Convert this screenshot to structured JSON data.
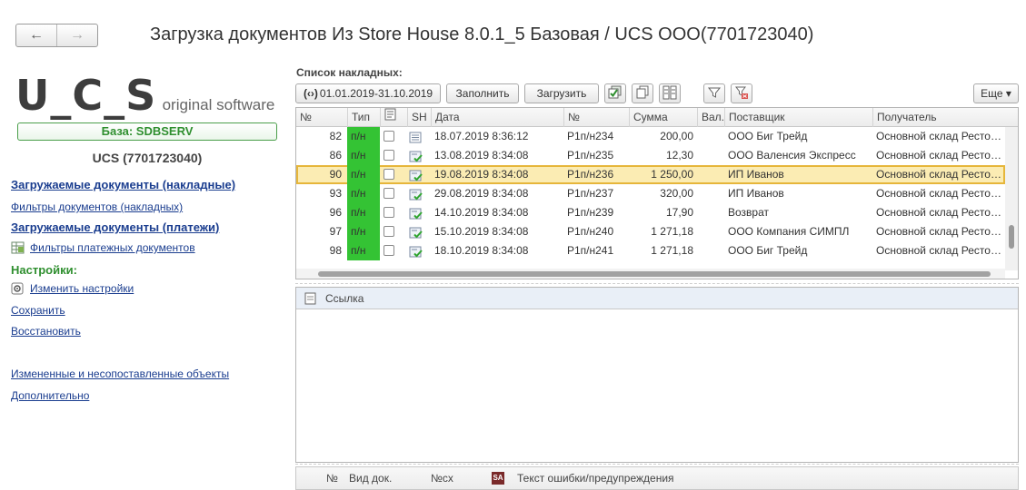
{
  "window": {
    "title": "Загрузка документов Из Store House 8.0.1_5 Базовая   / UCS ООО(7701723040)",
    "back_glyph": "←",
    "forward_glyph": "→"
  },
  "left_panel": {
    "logo_main": "U_C_S",
    "logo_sub": "original software",
    "database_label": "База: SDBSERV",
    "company": "UCS (7701723040)",
    "links": [
      {
        "label": "Загружаемые документы (накладные)",
        "bold": true
      },
      {
        "label": "Фильтры документов (накладных)",
        "bold": false
      },
      {
        "label": "Загружаемые документы (платежи)",
        "bold": true
      },
      {
        "label": "Фильтры платежных документов",
        "bold": false,
        "icon": "table-filter-icon"
      }
    ],
    "settings_heading": "Настройки:",
    "settings_links": [
      {
        "label": "Изменить настройки",
        "icon": "settings-gear-icon"
      },
      {
        "label": "Сохранить"
      },
      {
        "label": "Восстановить"
      }
    ],
    "extra_links": [
      {
        "label": "Измененные и несопоставленные объекты"
      },
      {
        "label": "Дополнительно"
      }
    ]
  },
  "list": {
    "title": "Список накладных:",
    "toolbar": {
      "period_label": "01.01.2019-31.10.2019",
      "fill_label": "Заполнить",
      "load_label": "Загрузить",
      "more_label": "Еще ▾",
      "icons": [
        "check-all-icon",
        "copy-icon",
        "columns-icon",
        "filter-icon",
        "clear-filter-icon"
      ]
    },
    "columns": [
      "№",
      "Тип",
      "",
      "SH",
      "Дата",
      "№",
      "Сумма",
      "Вал.",
      "Поставщик",
      "Получатель"
    ],
    "rows": [
      {
        "num": "82",
        "type": "п/н",
        "checked": false,
        "sh": "doc-icon",
        "date": "18.07.2019 8:36:12",
        "doc_no": "Р1п/н234",
        "sum": "200,00",
        "cur": "",
        "supplier": "ООО Биг Трейд",
        "recipient": "Основной склад Ресторан"
      },
      {
        "num": "86",
        "type": "п/н",
        "checked": false,
        "sh": "doc-check-icon",
        "date": "13.08.2019 8:34:08",
        "doc_no": "Р1п/н235",
        "sum": "12,30",
        "cur": "",
        "supplier": "ООО Валенсия Экспресс",
        "recipient": "Основной склад Ресторан"
      },
      {
        "num": "90",
        "type": "п/н",
        "checked": false,
        "sh": "doc-check-icon",
        "date": "19.08.2019 8:34:08",
        "doc_no": "Р1п/н236",
        "sum": "1 250,00",
        "cur": "",
        "supplier": "ИП Иванов",
        "recipient": "Основной склад Ресторан",
        "selected": true
      },
      {
        "num": "93",
        "type": "п/н",
        "checked": false,
        "sh": "doc-check-icon",
        "date": "29.08.2019 8:34:08",
        "doc_no": "Р1п/н237",
        "sum": "320,00",
        "cur": "",
        "supplier": "ИП Иванов",
        "recipient": "Основной склад Ресторан"
      },
      {
        "num": "96",
        "type": "п/н",
        "checked": false,
        "sh": "doc-check-icon",
        "date": "14.10.2019 8:34:08",
        "doc_no": "Р1п/н239",
        "sum": "17,90",
        "cur": "",
        "supplier": "Возврат",
        "recipient": "Основной склад Ресторан"
      },
      {
        "num": "97",
        "type": "п/н",
        "checked": false,
        "sh": "doc-check-icon",
        "date": "15.10.2019 8:34:08",
        "doc_no": "Р1п/н240",
        "sum": "1 271,18",
        "cur": "",
        "supplier": "ООО Компания СИМПЛ",
        "recipient": "Основной склад Ресторан"
      },
      {
        "num": "98",
        "type": "п/н",
        "checked": false,
        "sh": "doc-check-icon",
        "date": "18.10.2019 8:34:08",
        "doc_no": "Р1п/н241",
        "sum": "1 271,18",
        "cur": "",
        "supplier": "ООО Биг Трейд",
        "recipient": "Основной склад Ресторан"
      }
    ]
  },
  "link_panel": {
    "label": "Ссылка"
  },
  "error_table": {
    "columns": [
      "№",
      "Вид док.",
      "№сх",
      "Текст ошибки/предупреждения"
    ],
    "sa_icon_text": "SA"
  },
  "colors": {
    "type_green": "#34c334",
    "selected_row": "#fbecb3",
    "link_blue": "#1a3d8f",
    "accent_green": "#2f8f2f"
  }
}
